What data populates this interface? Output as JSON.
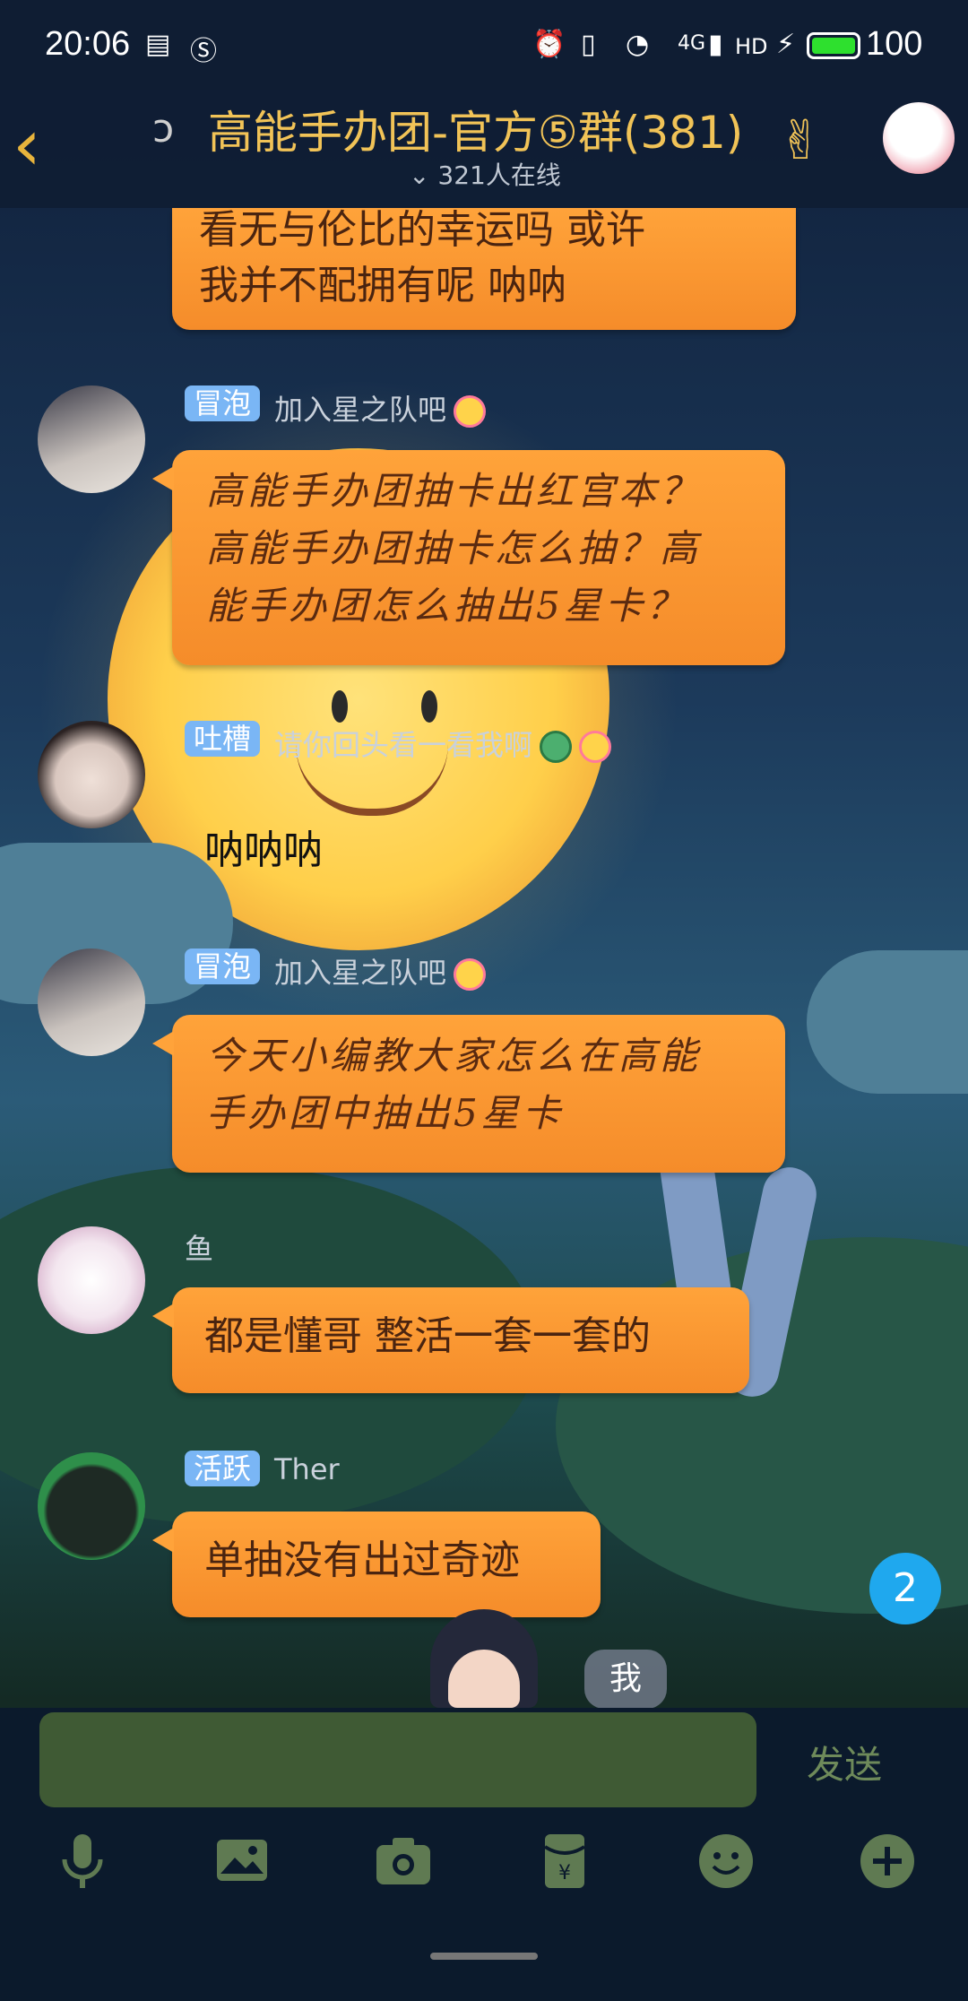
{
  "status_bar": {
    "time": "20:06",
    "battery_level": "100",
    "network": "4G",
    "hd": "HD"
  },
  "header": {
    "group_name": "高能手办团-官方⑤群(381)",
    "online_count": "321人在线"
  },
  "messages": [
    {
      "type": "partial",
      "text": "看无与伦比的幸运吗 或许\n我并不配拥有呢 呐呐"
    },
    {
      "badge": "冒泡",
      "nick": "加入星之队吧",
      "text": "高能手办团抽卡出红宫本？\n高能手办团抽卡怎么抽？高\n能手办团怎么抽出5星卡？"
    },
    {
      "badge": "吐槽",
      "nick": "请你回头看一看我啊",
      "text": "呐呐呐"
    },
    {
      "badge": "冒泡",
      "nick": "加入星之队吧",
      "text": "今天小编教大家怎么在高能\n手办团中抽出5星卡"
    },
    {
      "badge": "",
      "nick": "鱼",
      "text": "都是懂哥 整活一套一套的"
    },
    {
      "badge": "活跃",
      "nick": "Ther",
      "text": "单抽没有出过奇迹"
    }
  ],
  "unread_count": "2",
  "me_label": "我",
  "input": {
    "value": "",
    "send_label": "发送"
  },
  "toolbar": [
    "mic-icon",
    "image-icon",
    "camera-icon",
    "red-packet-icon",
    "emoji-icon",
    "plus-icon"
  ],
  "colors": {
    "bubble": "#ffa33a",
    "title": "#f1c357",
    "badge": "#7ab6f5",
    "unread": "#1fa8ee"
  }
}
